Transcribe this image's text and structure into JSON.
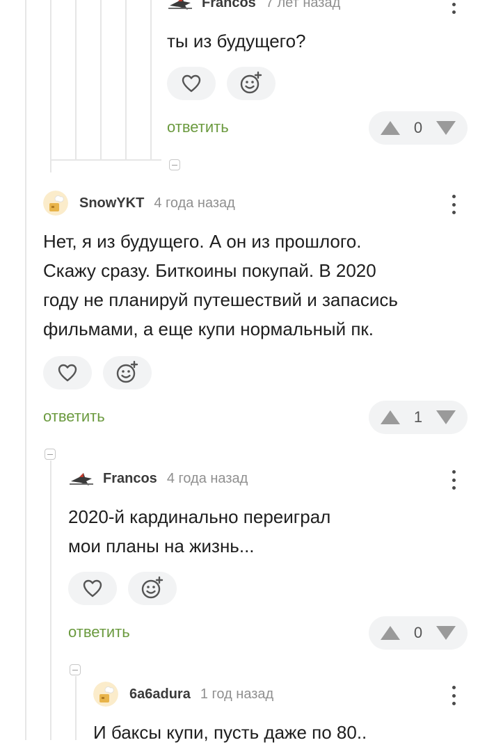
{
  "comments": [
    {
      "author": "Francos",
      "time": "7 лет назад",
      "text": "ты из будущего?",
      "reply_label": "ответить",
      "rating": "0",
      "avatar_icon": "bird-logo-icon"
    },
    {
      "author": "SnowYKT",
      "time": "4 года назад",
      "text_lines": [
        "Нет, я из будущего. А он из прошлого.",
        "Скажу сразу. Биткоины покупай. В 2020",
        "году не планируй путешествий и запасись",
        "фильмами, а еще купи нормальный пк."
      ],
      "reply_label": "ответить",
      "rating": "1",
      "avatar_icon": "default-avatar-icon"
    },
    {
      "author": "Francos",
      "time": "4 года назад",
      "text_lines": [
        "2020-й кардинально переиграл",
        "мои планы на жизнь..."
      ],
      "reply_label": "ответить",
      "rating": "0",
      "avatar_icon": "bird-logo-icon"
    },
    {
      "author": "6a6adura",
      "time": "1 год назад",
      "text": "И баксы купи, пусть даже по 80..",
      "avatar_icon": "default-avatar-icon"
    }
  ],
  "colors": {
    "reply": "#6b9a3f",
    "pill_bg": "#f2f3f4",
    "vote_arrow": "#9a9a9a",
    "thread_line": "#e6e6e6"
  }
}
